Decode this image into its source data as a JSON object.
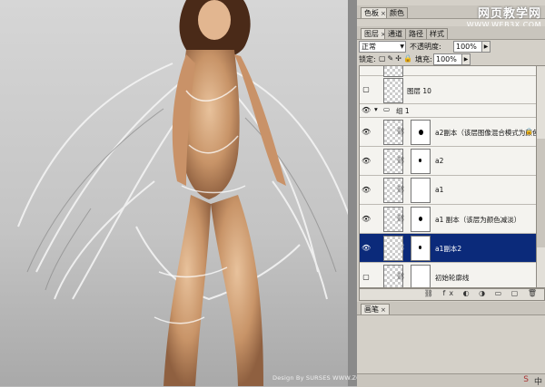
{
  "canvas": {
    "credit": "Design By SURSES WWW.ZCOOL.COM.CN  QQ:6782221"
  },
  "top_tabs": [
    {
      "label": "色板",
      "close": "×"
    },
    {
      "label": "颜色",
      "close": ""
    }
  ],
  "watermark": {
    "title": "网页教学网",
    "url": "WWW.WEB3X.COM"
  },
  "layers_panel": {
    "tabs": [
      {
        "label": "图层",
        "close": "×",
        "active": true
      },
      {
        "label": "通道",
        "active": false
      },
      {
        "label": "路径",
        "active": false
      },
      {
        "label": "样式",
        "active": false
      }
    ],
    "blend_mode": "正常",
    "opacity_label": "不透明度:",
    "opacity_value": "100%",
    "lock_label": "锁定:",
    "fill_label": "填充:",
    "fill_value": "100%",
    "layers": [
      {
        "name": "",
        "type": "partial"
      },
      {
        "name": "图层 10",
        "type": "single"
      },
      {
        "name": "组 1",
        "type": "group"
      },
      {
        "name": "a2副本（该层图像混合模式为颜色加...",
        "type": "masked"
      },
      {
        "name": "a2",
        "type": "masked"
      },
      {
        "name": "a1",
        "type": "masked"
      },
      {
        "name": "a1 副本（该层为颜色减淡）",
        "type": "masked"
      },
      {
        "name": "a1副本2",
        "type": "masked",
        "selected": true
      },
      {
        "name": "初始轮廓线",
        "type": "masked"
      }
    ]
  },
  "bottom_tabs": [
    {
      "label": "画笔",
      "close": "×"
    }
  ],
  "bottom_badge": "中"
}
